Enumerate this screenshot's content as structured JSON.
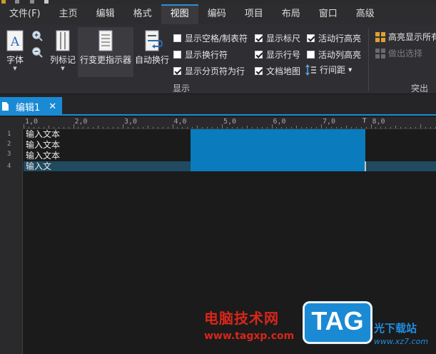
{
  "menu": [
    {
      "label": "文件(F)",
      "name": "menu-file"
    },
    {
      "label": "主页",
      "name": "menu-home"
    },
    {
      "label": "编辑",
      "name": "menu-edit"
    },
    {
      "label": "格式",
      "name": "menu-format"
    },
    {
      "label": "视图",
      "name": "menu-view",
      "active": true
    },
    {
      "label": "编码",
      "name": "menu-encoding"
    },
    {
      "label": "项目",
      "name": "menu-project"
    },
    {
      "label": "布局",
      "name": "menu-layout"
    },
    {
      "label": "窗口",
      "name": "menu-window"
    },
    {
      "label": "高级",
      "name": "menu-advanced"
    }
  ],
  "ribbon": {
    "font_label": "字体",
    "bookmark_label": "列标记",
    "change_indicator_label": "行变更指示器",
    "word_wrap_label": "自动换行",
    "checks": {
      "show_spaces_tabs": {
        "label": "显示空格/制表符",
        "checked": false
      },
      "show_line_breaks": {
        "label": "显示换行符",
        "checked": false
      },
      "show_page_breaks": {
        "label": "显示分页符为行",
        "checked": true
      },
      "show_ruler": {
        "label": "显示标尺",
        "checked": true
      },
      "show_line_numbers": {
        "label": "显示行号",
        "checked": true
      },
      "doc_map": {
        "label": "文档地图",
        "checked": true
      },
      "active_line_highlight": {
        "label": "活动行高亮",
        "checked": true
      },
      "active_col_highlight": {
        "label": "活动列高亮",
        "checked": false
      }
    },
    "line_spacing_label": "行间距",
    "display_group_label": "显示",
    "highlight_all_label": "高亮显示所有",
    "make_selection_label": "做出选择",
    "highlight_group_label": "突出"
  },
  "tab": {
    "title": "编辑1"
  },
  "ruler": {
    "labels": [
      "1,0",
      "2,0",
      "3,0",
      "4,0",
      "5,0",
      "6,0",
      "7,0",
      "8,0"
    ]
  },
  "editor": {
    "line_numbers": [
      "1",
      "2",
      "3",
      "4"
    ],
    "lines": [
      "输入文本",
      "输入文本",
      "输入文本",
      "输入文"
    ]
  },
  "watermark": {
    "site_cn": "电脑技术网",
    "site_url": "www.tagxp.com",
    "tag": "TAG",
    "right_cn": "光下载站",
    "right_url": "www.xz7.com"
  },
  "colors": {
    "accent": "#1a8ad4",
    "selection": "#0a7bbd",
    "current_line": "#1f4a60",
    "watermark_red": "#d8261b"
  }
}
